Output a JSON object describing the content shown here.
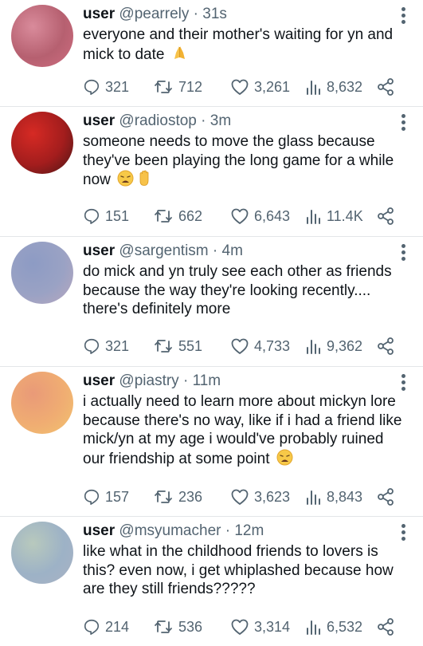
{
  "tweets": [
    {
      "name": "user",
      "handle": "@pearrely",
      "sep": "·",
      "time": "31s",
      "text": "everyone and their mother's waiting for yn and mick to date",
      "emojis": [
        "folded-hands"
      ],
      "replies": "321",
      "retweets": "712",
      "likes": "3,261",
      "views": "8,632",
      "avatar_colors": [
        "#cf6d80",
        "#b66070",
        "#d98b9b"
      ]
    },
    {
      "name": "user",
      "handle": "@radiostop",
      "sep": "·",
      "time": "3m",
      "text": "someone needs to move the glass because they've been playing the long game for a while now",
      "emojis": [
        "weary-face",
        "raised-hand"
      ],
      "replies": "151",
      "retweets": "662",
      "likes": "6,643",
      "views": "11.4K",
      "avatar_colors": [
        "#4a1616",
        "#a31d1d",
        "#d62a24"
      ]
    },
    {
      "name": "user",
      "handle": "@sargentism",
      "sep": "·",
      "time": "4m",
      "text": "do mick and yn truly see each other as friends because the way they're looking recently.... there's definitely more",
      "emojis": [],
      "replies": "321",
      "retweets": "551",
      "likes": "4,733",
      "views": "9,362",
      "avatar_colors": [
        "#b8a7bf",
        "#9aa2c4",
        "#8d9bc4"
      ]
    },
    {
      "name": "user",
      "handle": "@piastry",
      "sep": "·",
      "time": "11m",
      "text": "i actually need to learn more about mickyn lore because there's no way, like if i had a friend like mick/yn at my age i would've probably ruined our friendship at some point",
      "emojis": [
        "weary-face"
      ],
      "replies": "157",
      "retweets": "236",
      "likes": "3,623",
      "views": "8,843",
      "avatar_colors": [
        "#f2c36f",
        "#f0ad72",
        "#e99a78"
      ]
    },
    {
      "name": "user",
      "handle": "@msyumacher",
      "sep": "·",
      "time": "12m",
      "text": "like what in the childhood friends to lovers is this? even now, i get whiplashed because how are they still friends?????",
      "emojis": [],
      "replies": "214",
      "retweets": "536",
      "likes": "3,314",
      "views": "6,532",
      "avatar_colors": [
        "#a9b1c4",
        "#9db2c6",
        "#b8c9bd"
      ]
    }
  ]
}
